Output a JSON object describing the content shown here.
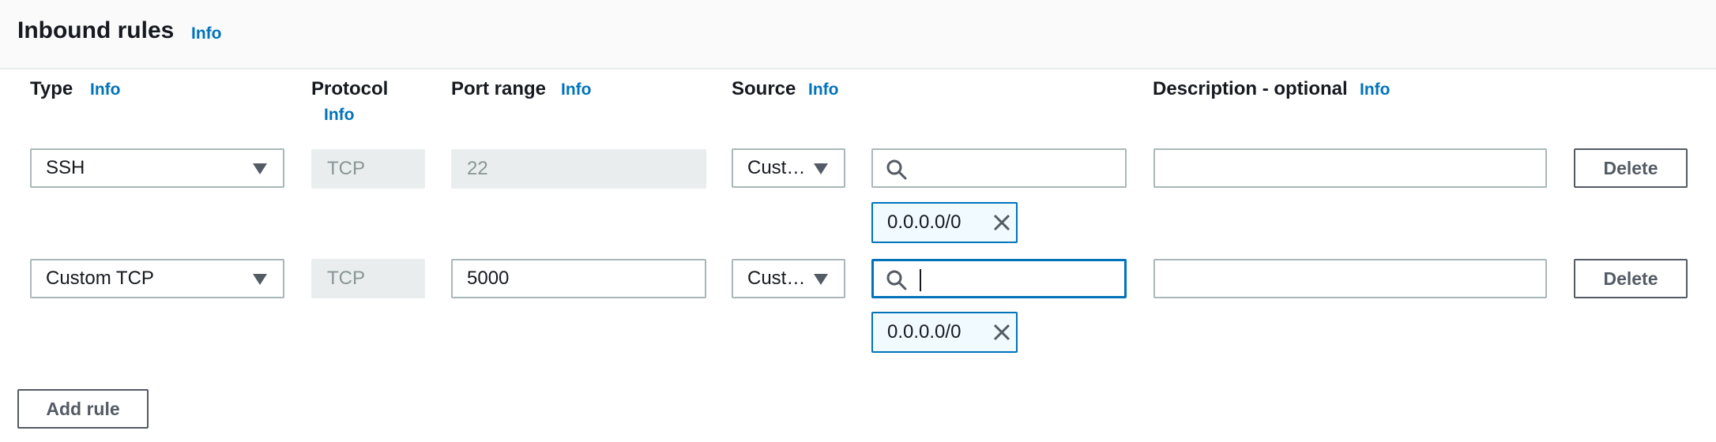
{
  "header": {
    "title": "Inbound rules",
    "info": "Info"
  },
  "columns": {
    "type": "Type",
    "protocol": "Protocol",
    "port_range": "Port range",
    "source": "Source",
    "description": "Description - optional",
    "info": "Info"
  },
  "rules": [
    {
      "type": "SSH",
      "protocol": "TCP",
      "port_range": "22",
      "source": "Cust…",
      "search_value": "",
      "cidr": "0.0.0.0/0",
      "description": "",
      "delete_label": "Delete"
    },
    {
      "type": "Custom TCP",
      "protocol": "TCP",
      "port_range": "5000",
      "source": "Cust…",
      "search_value": "",
      "cidr": "0.0.0.0/0",
      "description": "",
      "delete_label": "Delete"
    }
  ],
  "footer": {
    "add_rule_label": "Add rule"
  },
  "colors": {
    "accent": "#0073bb",
    "text": "#16191f",
    "disabled_bg": "#eaeded",
    "border": "#aab7b8"
  },
  "icons": {
    "search": "search-icon",
    "remove": "close-icon",
    "dropdown": "caret-down-icon"
  }
}
